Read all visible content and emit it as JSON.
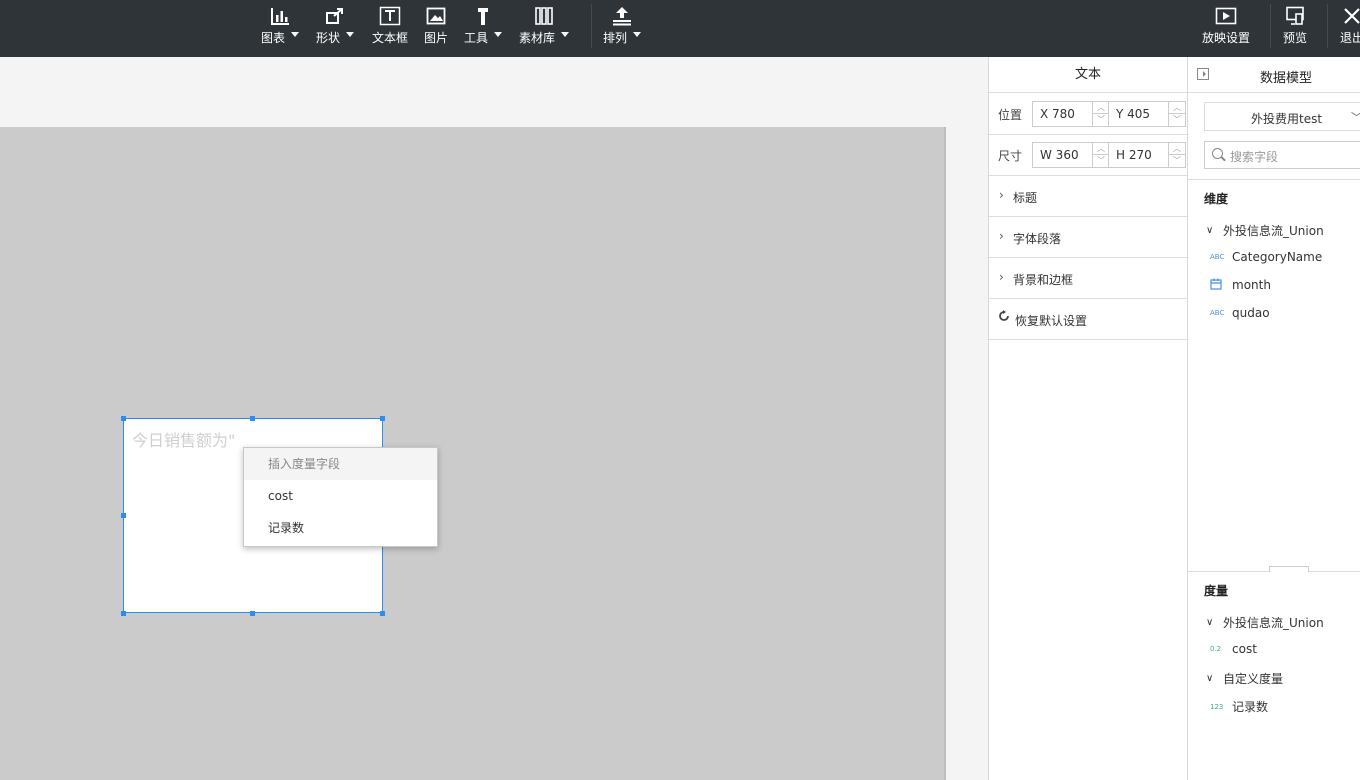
{
  "toolbar": {
    "items": [
      {
        "label": "图表",
        "icon": "bar-chart-icon",
        "dropdown": true
      },
      {
        "label": "形状",
        "icon": "shape-icon",
        "dropdown": true
      },
      {
        "label": "文本框",
        "icon": "textbox-icon",
        "dropdown": false
      },
      {
        "label": "图片",
        "icon": "image-icon",
        "dropdown": false
      },
      {
        "label": "工具",
        "icon": "hammer-icon",
        "dropdown": true
      },
      {
        "label": "素材库",
        "icon": "library-icon",
        "dropdown": true
      },
      {
        "label": "排列",
        "icon": "arrange-icon",
        "dropdown": true
      }
    ],
    "right": [
      {
        "label": "放映设置",
        "icon": "play-icon"
      },
      {
        "label": "预览",
        "icon": "preview-icon"
      },
      {
        "label": "退出",
        "icon": "close-icon"
      }
    ]
  },
  "canvas": {
    "textbox_placeholder": "今日销售额为\"",
    "context_menu": {
      "header": "插入度量字段",
      "items": [
        "cost",
        "记录数"
      ]
    }
  },
  "text_panel": {
    "title": "文本",
    "position_label": "位置",
    "size_label": "尺寸",
    "x": "X 780",
    "y": "Y 405",
    "w": "W 360",
    "h": "H 270",
    "sections": [
      "标题",
      "字体段落",
      "背景和边框"
    ],
    "reset_label": "恢复默认设置"
  },
  "data_panel": {
    "title": "数据模型",
    "dataset": "外投费用test",
    "search_placeholder": "搜索字段",
    "dimensions_title": "维度",
    "dimension_group": "外投信息流_Union",
    "dimension_fields": [
      {
        "name": "CategoryName",
        "type": "ABC"
      },
      {
        "name": "month",
        "type": "date"
      },
      {
        "name": "qudao",
        "type": "ABC"
      }
    ],
    "measures_title": "度量",
    "measure_group": "外投信息流_Union",
    "measure_fields": [
      {
        "name": "cost",
        "type": "0.2"
      }
    ],
    "custom_group": "自定义度量",
    "custom_fields": [
      {
        "name": "记录数",
        "type": "123"
      }
    ]
  }
}
